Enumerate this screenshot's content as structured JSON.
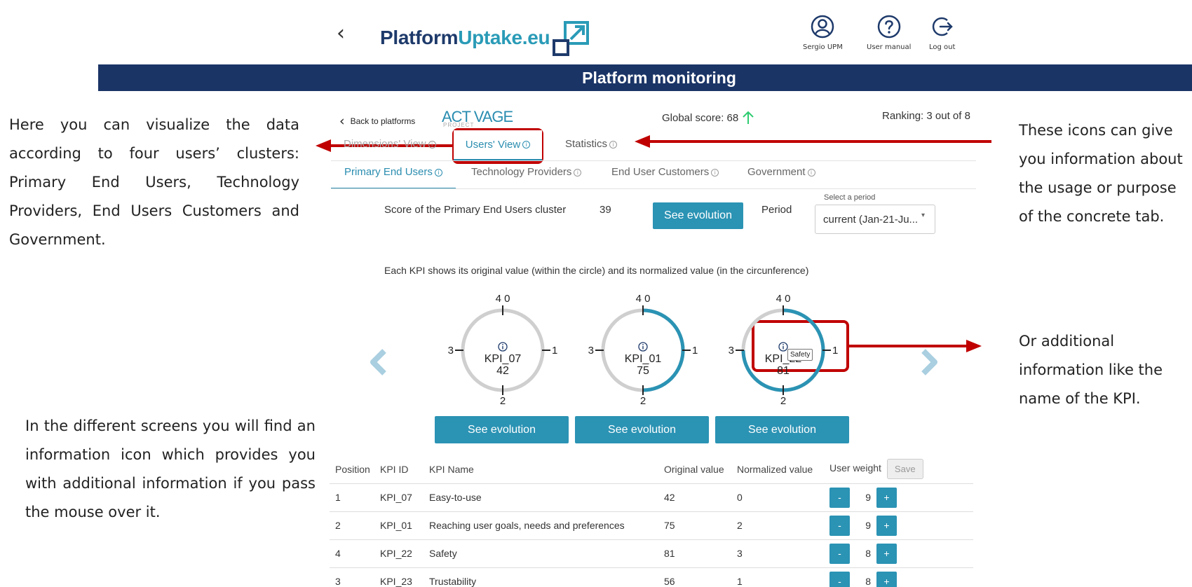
{
  "header": {
    "back": "‹",
    "logo_part1": "Platform",
    "logo_part2": "Uptake.eu",
    "user_label": "Sergio UPM",
    "manual_label": "User manual",
    "logout_label": "Log out"
  },
  "banner": {
    "title": "Platform monitoring"
  },
  "notes": {
    "left_top": "Here you can visualize the data according to four users’ clusters: Primary End Users, Technology Providers, End Users Customers and Government.",
    "left_bottom": "In the different screens you will find an information icon which provides you with additional information if you pass the mouse over it.",
    "right_top": "These icons can give you information about the usage or purpose of the concrete tab.",
    "right_bottom": "Or additional information like the name of the KPI."
  },
  "panel": {
    "back_link": "Back to platforms",
    "project_logo": "ACT VAGE",
    "project_sub": "PROJECT",
    "global_score": "Global score: 68",
    "ranking": "Ranking: 3 out of 8",
    "view_tabs": [
      "Dimensions' View",
      "Users' View",
      "Statistics"
    ],
    "cluster_tabs": [
      "Primary End Users",
      "Technology Providers",
      "End User Customers",
      "Government"
    ],
    "score_label": "Score of the Primary End Users cluster",
    "score_value": "39",
    "see_evolution": "See evolution",
    "period_label": "Period",
    "select_period_hint": "Select a period",
    "period_value": "current (Jan-21-Ju...",
    "kpi_caption": "Each KPI shows its original value (within the circle) and its normalized value (in the circunference)"
  },
  "kpi_charts": [
    {
      "id": "KPI_07",
      "value": "42",
      "normalized": 0,
      "tooltip": ""
    },
    {
      "id": "KPI_01",
      "value": "75",
      "normalized": 2,
      "tooltip": ""
    },
    {
      "id": "KPI_22",
      "value": "81",
      "normalized": 3,
      "tooltip": "Safety"
    }
  ],
  "dial_ticks": {
    "top": "4 0",
    "right": "1",
    "bottom": "2",
    "left": "3"
  },
  "table": {
    "headers": [
      "Position",
      "KPI ID",
      "KPI Name",
      "Original value",
      "Normalized value",
      "User weight"
    ],
    "save_label": "Save",
    "minus": "-",
    "plus": "+",
    "rows": [
      {
        "pos": "1",
        "id": "KPI_07",
        "name": "Easy-to-use",
        "orig": "42",
        "norm": "0",
        "weight": "9"
      },
      {
        "pos": "2",
        "id": "KPI_01",
        "name": "Reaching user goals, needs and preferences",
        "orig": "75",
        "norm": "2",
        "weight": "9"
      },
      {
        "pos": "4",
        "id": "KPI_22",
        "name": "Safety",
        "orig": "81",
        "norm": "3",
        "weight": "8"
      },
      {
        "pos": "3",
        "id": "KPI_23",
        "name": "Trustability",
        "orig": "56",
        "norm": "1",
        "weight": "8"
      }
    ]
  },
  "colors": {
    "accent": "#2b93b4",
    "navy": "#1a3466",
    "annotation_red": "#c00000",
    "arrow_green": "#2ecc71"
  }
}
